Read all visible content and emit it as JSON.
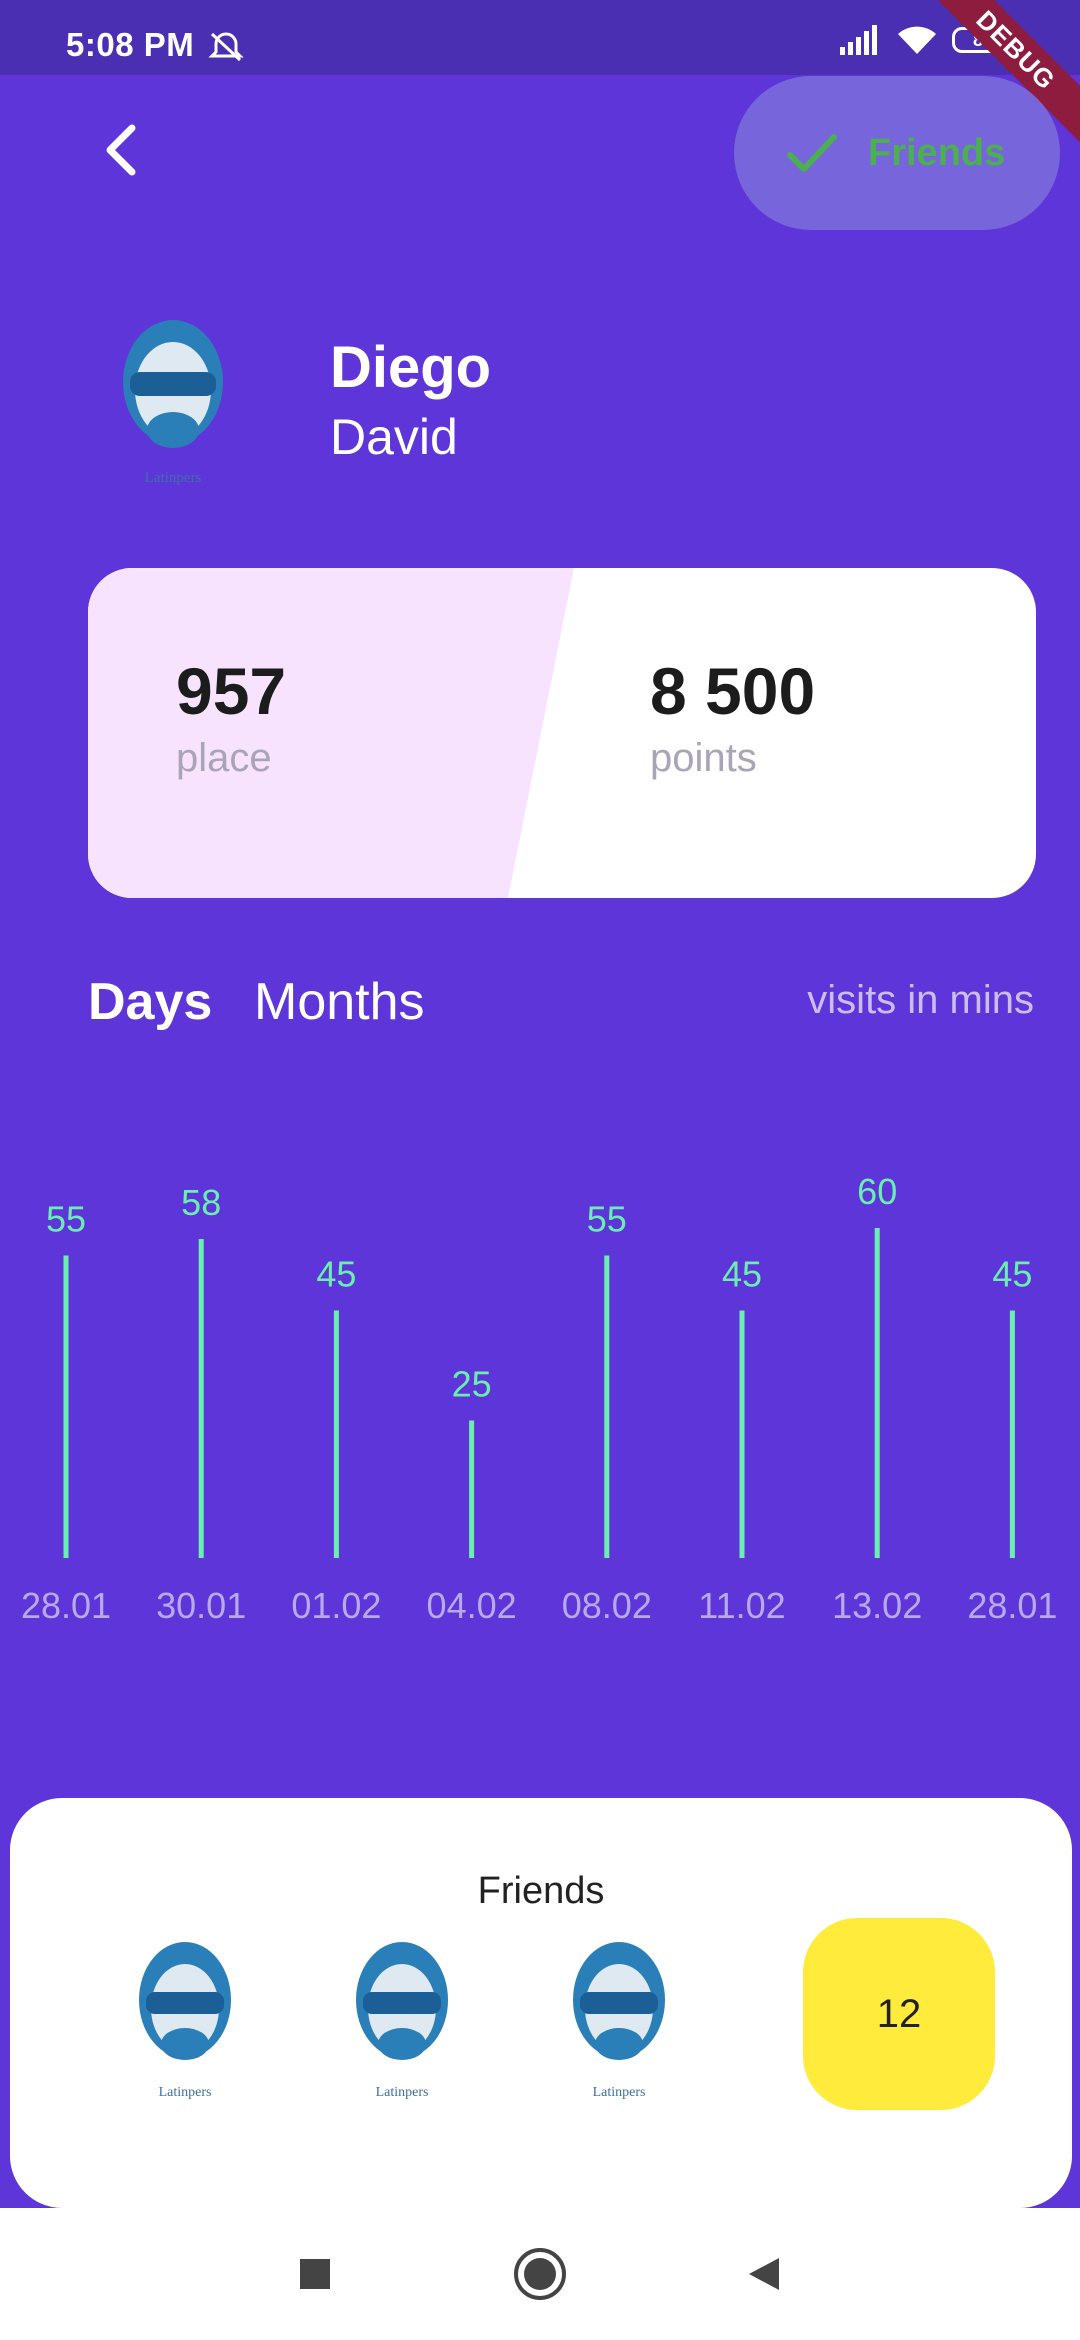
{
  "status_bar": {
    "time": "5:08 PM",
    "battery": "81",
    "debug_label": "DEBUG"
  },
  "header": {
    "friends_button_label": "Friends"
  },
  "profile": {
    "first_name": "Diego",
    "last_name": "David",
    "avatar_caption": "Latinpers"
  },
  "stats": {
    "place_value": "957",
    "place_label": "place",
    "points_value": "8 500",
    "points_label": "points"
  },
  "tabs": [
    {
      "label": "Days",
      "active": true
    },
    {
      "label": "Months",
      "active": false
    }
  ],
  "visits_label": "visits in mins",
  "chart_data": {
    "type": "bar",
    "categories": [
      "28.01",
      "30.01",
      "01.02",
      "04.02",
      "08.02",
      "11.02",
      "13.02",
      "28.01"
    ],
    "values": [
      55,
      58,
      45,
      25,
      55,
      45,
      60,
      45
    ],
    "bar_color": "#69f0ae",
    "label_color": "#69f0ae",
    "tick_color": "#b8a9ea"
  },
  "friends_panel": {
    "title": "Friends",
    "count": "12",
    "avatar_caption": "Latinpers"
  },
  "colors": {
    "background": "#5e35d9",
    "accent_yellow": "#ffeb3b",
    "check_green": "#4caf50",
    "card_pink": "#f8e3ff"
  },
  "nav_bar": {
    "icons": [
      "square-icon",
      "home-circle-icon",
      "back-triangle-icon"
    ]
  }
}
